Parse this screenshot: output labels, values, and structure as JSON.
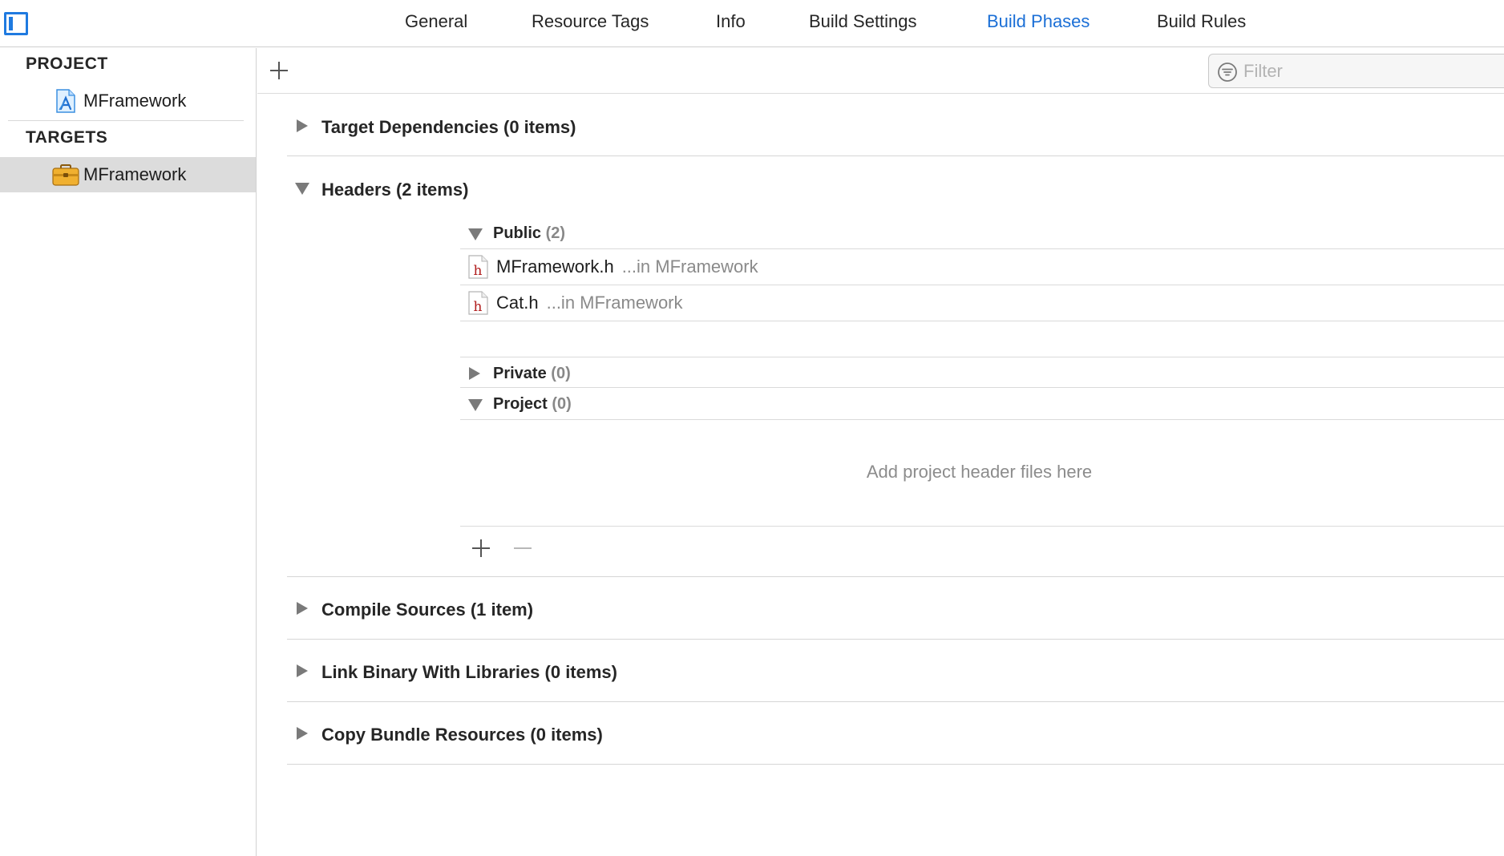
{
  "tabs": [
    {
      "label": "General",
      "active": false
    },
    {
      "label": "Resource Tags",
      "active": false
    },
    {
      "label": "Info",
      "active": false
    },
    {
      "label": "Build Settings",
      "active": false
    },
    {
      "label": "Build Phases",
      "active": true
    },
    {
      "label": "Build Rules",
      "active": false
    }
  ],
  "sidebar": {
    "project_heading": "PROJECT",
    "project_item": "MFramework",
    "targets_heading": "TARGETS",
    "target_item": "MFramework"
  },
  "toolbar": {
    "filter_placeholder": "Filter"
  },
  "phases": {
    "target_dependencies": "Target Dependencies (0 items)",
    "headers": "Headers (2 items)",
    "compile_sources": "Compile Sources (1 item)",
    "link_binary": "Link Binary With Libraries (0 items)",
    "copy_bundle": "Copy Bundle Resources (0 items)"
  },
  "headers": {
    "public": {
      "label": "Public",
      "count": "(2)"
    },
    "files": [
      {
        "name": "MFramework.h",
        "location": "...in MFramework",
        "icon_letter": "h"
      },
      {
        "name": "Cat.h",
        "location": "...in MFramework",
        "icon_letter": "h"
      }
    ],
    "private": {
      "label": "Private",
      "count": "(0)"
    },
    "project": {
      "label": "Project",
      "count": "(0)"
    },
    "empty_message": "Add project header files here"
  },
  "colors": {
    "accent": "#1b6fd6",
    "selected_row": "#dcdcdc",
    "header_file_icon": "#b01b1b",
    "target_icon": "#e8a825"
  }
}
